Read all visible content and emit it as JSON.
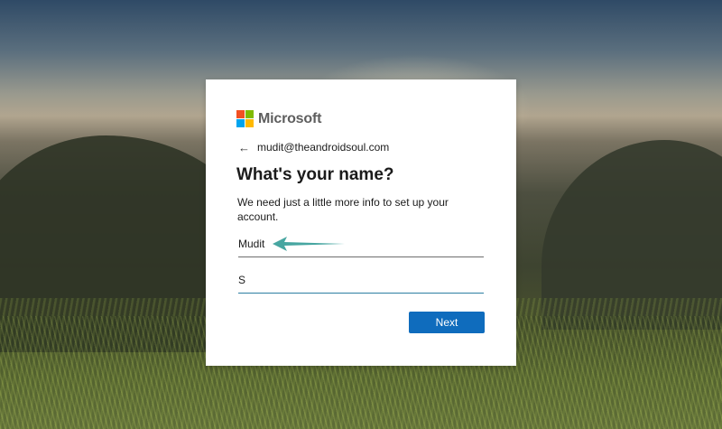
{
  "brand": {
    "name": "Microsoft",
    "logo_colors": [
      "#f25022",
      "#7fba00",
      "#00a4ef",
      "#ffb900"
    ]
  },
  "identity": {
    "back_icon": "arrow-left-icon",
    "email": "mudit@theandroidsoul.com"
  },
  "form": {
    "title": "What's your name?",
    "description": "We need just a little more info to set up your account.",
    "first_name_value": "Mudit",
    "last_name_value": "S",
    "next_label": "Next"
  },
  "colors": {
    "primary_button": "#0f6cbd",
    "annotation_arrow": "#47a6a1",
    "focused_underline": "#2d7fa2"
  }
}
